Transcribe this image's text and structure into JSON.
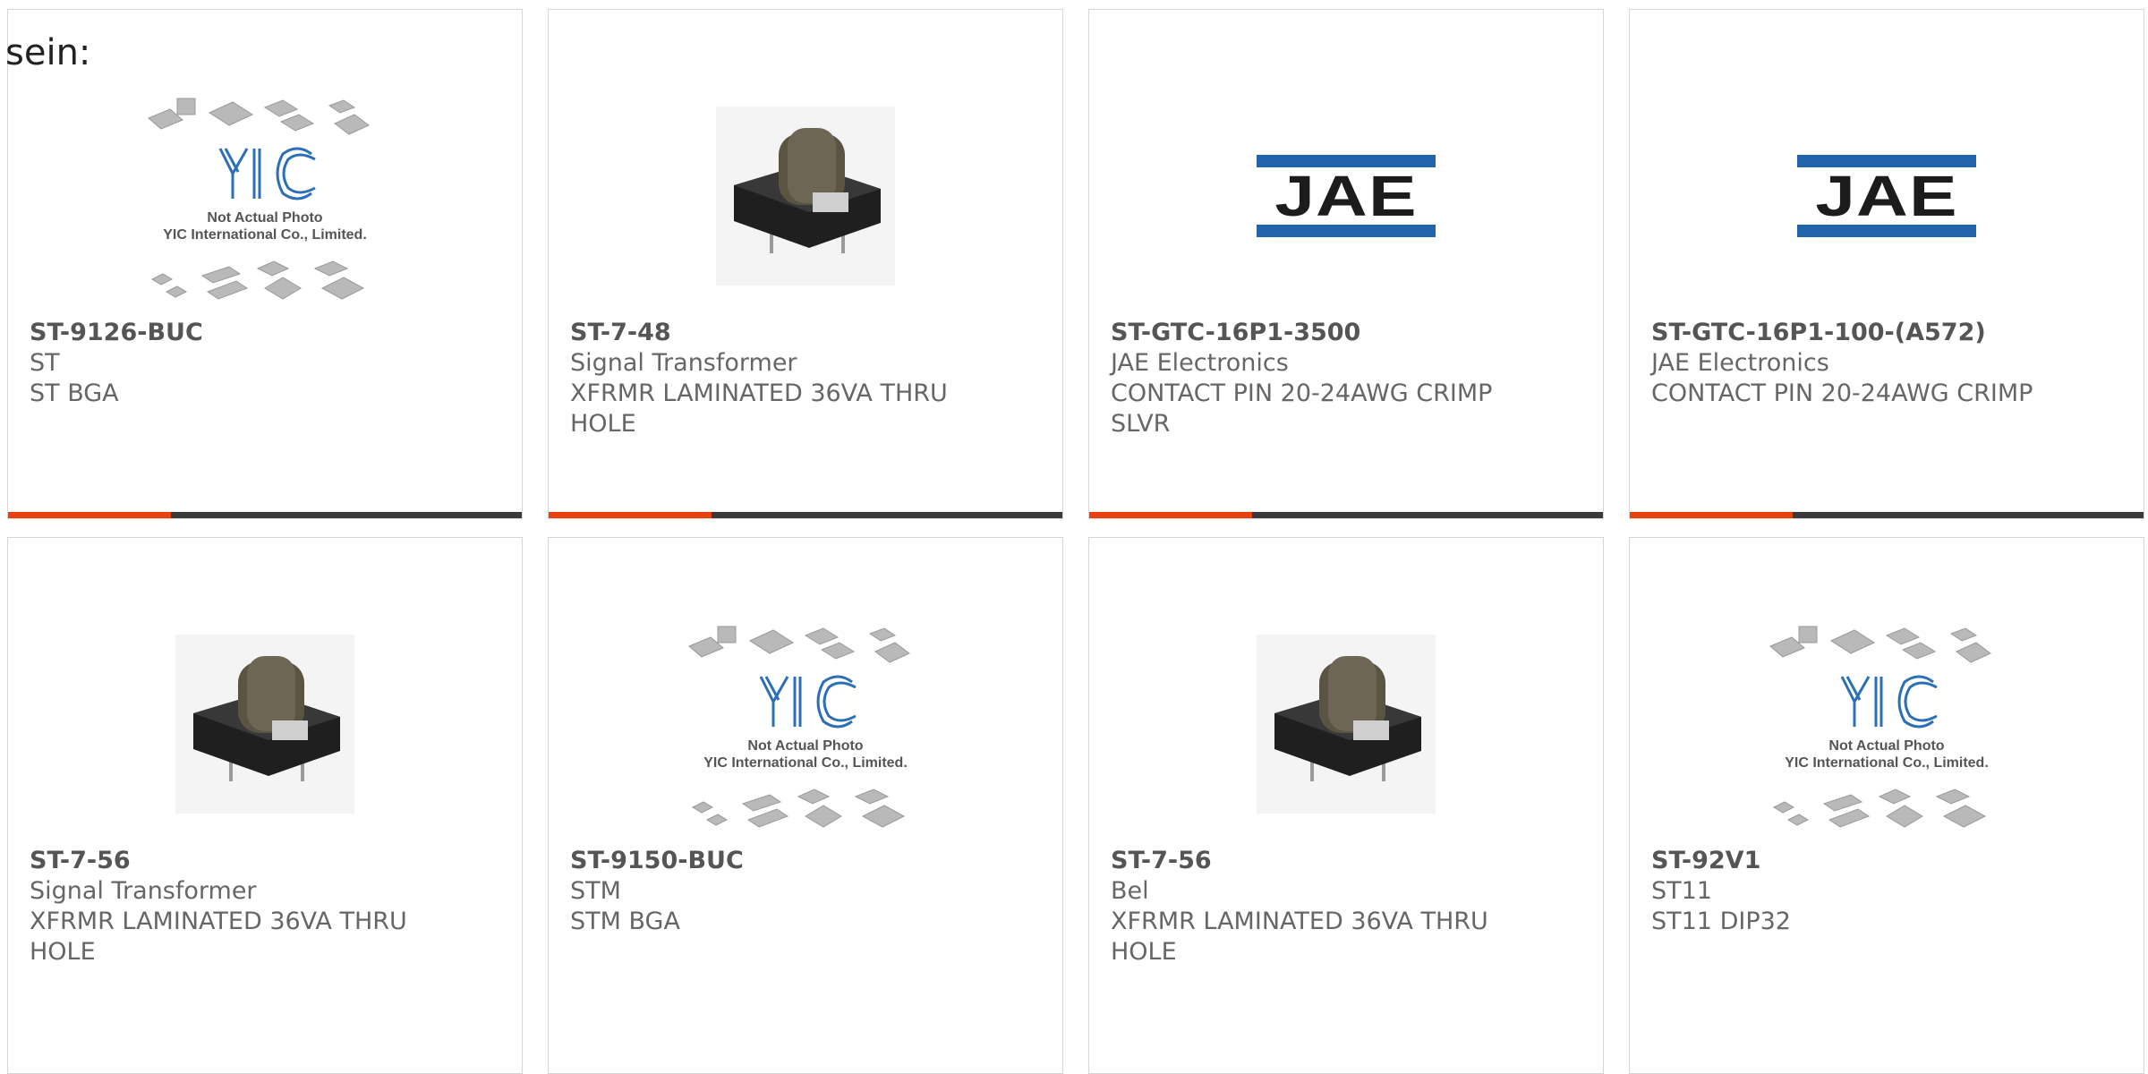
{
  "lead_text": "sein:",
  "colors": {
    "accent": "#e8400e",
    "bar": "#3a3a3a",
    "brand_blue": "#2265ad"
  },
  "products": [
    {
      "part": "ST-9126-BUC",
      "brand": "ST",
      "desc": "ST BGA",
      "image": "yic-placeholder"
    },
    {
      "part": "ST-7-48",
      "brand": "Signal Transformer",
      "desc": "XFRMR LAMINATED 36VA THRU HOLE",
      "image": "transformer-photo"
    },
    {
      "part": "ST-GTC-16P1-3500",
      "brand": "JAE Electronics",
      "desc": "CONTACT PIN 20-24AWG CRIMP SLVR",
      "image": "jae-logo"
    },
    {
      "part": "ST-GTC-16P1-100-(A572)",
      "brand": "JAE Electronics",
      "desc": "CONTACT PIN 20-24AWG CRIMP",
      "image": "jae-logo"
    },
    {
      "part": "ST-7-56",
      "brand": "Signal Transformer",
      "desc": "XFRMR LAMINATED 36VA THRU HOLE",
      "image": "transformer-photo"
    },
    {
      "part": "ST-9150-BUC",
      "brand": "STM",
      "desc": "STM BGA",
      "image": "yic-placeholder"
    },
    {
      "part": "ST-7-56",
      "brand": "Bel",
      "desc": "XFRMR LAMINATED 36VA THRU HOLE",
      "image": "transformer-photo"
    },
    {
      "part": "ST-92V1",
      "brand": "ST11",
      "desc": "ST11 DIP32",
      "image": "yic-placeholder"
    }
  ],
  "placeholder": {
    "line1": "Not Actual Photo",
    "line2": "YIC International Co., Limited.",
    "logo": "YIC"
  },
  "jae_logo_text": "JAE"
}
